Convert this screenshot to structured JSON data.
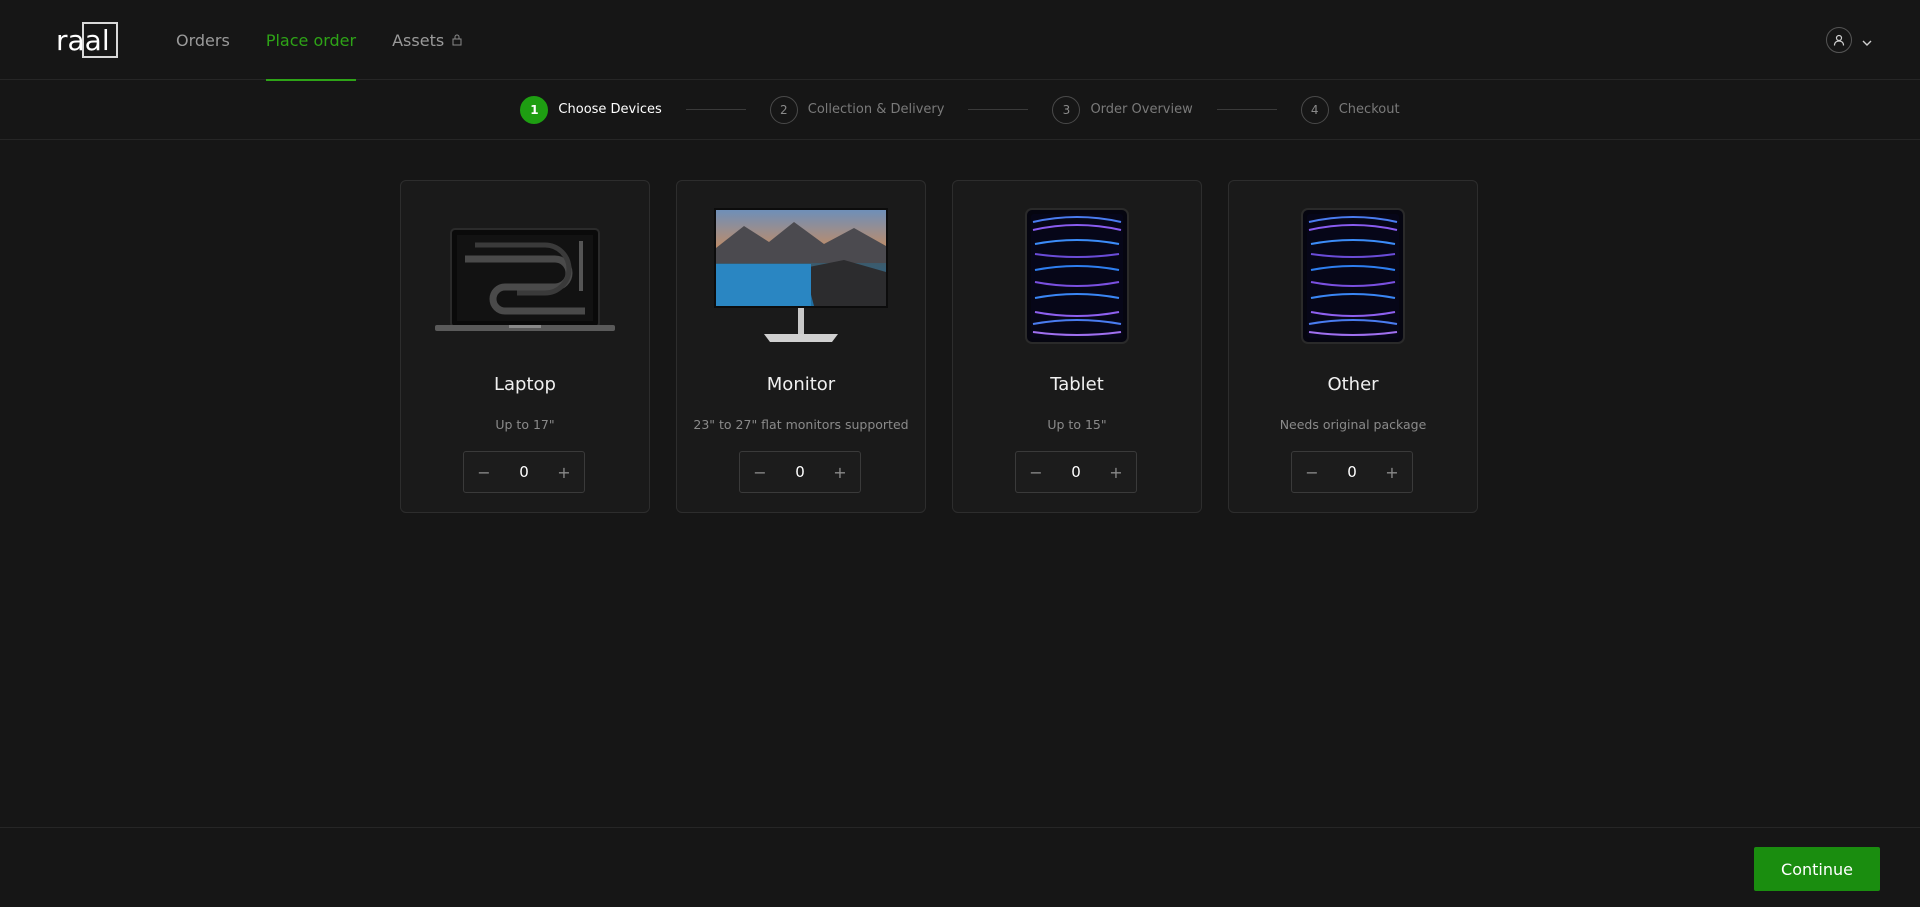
{
  "header": {
    "logo": "raal",
    "nav": [
      {
        "label": "Orders",
        "active": false
      },
      {
        "label": "Place order",
        "active": true
      },
      {
        "label": "Assets",
        "active": false,
        "locked": true
      }
    ],
    "icons": {
      "user": "user-icon",
      "chevron": "chevron-down-icon",
      "lock": "lock-icon"
    }
  },
  "steps": [
    {
      "number": "1",
      "label": "Choose Devices",
      "active": true
    },
    {
      "number": "2",
      "label": "Collection & Delivery",
      "active": false
    },
    {
      "number": "3",
      "label": "Order Overview",
      "active": false
    },
    {
      "number": "4",
      "label": "Checkout",
      "active": false
    }
  ],
  "cards": [
    {
      "title": "Laptop",
      "description": "Up to 17\"",
      "quantity": "0",
      "image": "laptop-image"
    },
    {
      "title": "Monitor",
      "description": "23\" to 27\" flat monitors supported",
      "quantity": "0",
      "image": "monitor-image"
    },
    {
      "title": "Tablet",
      "description": "Up to 15\"",
      "quantity": "0",
      "image": "tablet-image"
    },
    {
      "title": "Other",
      "description": "Needs original package",
      "quantity": "0",
      "image": "tablet-image"
    }
  ],
  "controls": {
    "decrement": "−",
    "increment": "+"
  },
  "footer": {
    "continue_label": "Continue"
  },
  "colors": {
    "accent": "#1e9e12",
    "background": "#161616",
    "card": "#1a1a1a"
  }
}
